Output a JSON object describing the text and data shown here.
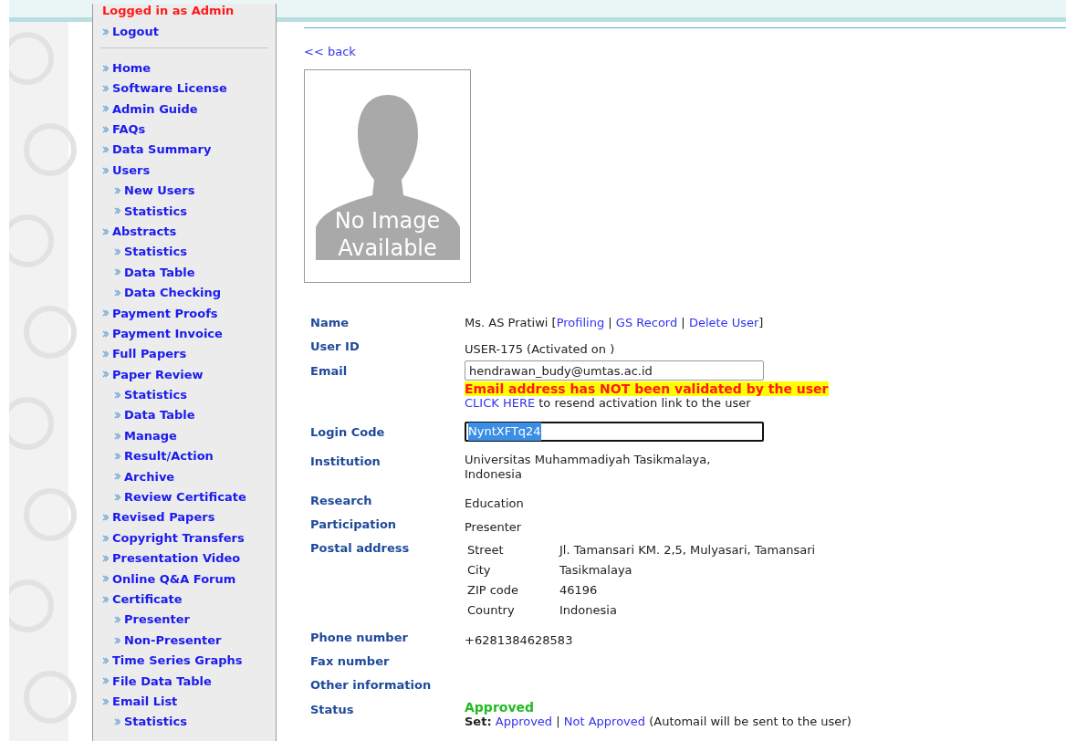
{
  "sidebar": {
    "login_status": "Logged in as Admin",
    "logout": "Logout",
    "items": [
      {
        "label": "Home"
      },
      {
        "label": "Software License"
      },
      {
        "label": "Admin Guide"
      },
      {
        "label": "FAQs"
      },
      {
        "label": "Data Summary"
      },
      {
        "label": "Users",
        "children": [
          {
            "label": "New Users"
          },
          {
            "label": "Statistics"
          }
        ]
      },
      {
        "label": "Abstracts",
        "children": [
          {
            "label": "Statistics"
          },
          {
            "label": "Data Table"
          },
          {
            "label": "Data Checking"
          }
        ]
      },
      {
        "label": "Payment Proofs"
      },
      {
        "label": "Payment Invoice"
      },
      {
        "label": "Full Papers"
      },
      {
        "label": "Paper Review",
        "children": [
          {
            "label": "Statistics"
          },
          {
            "label": "Data Table"
          },
          {
            "label": "Manage"
          },
          {
            "label": "Result/Action"
          },
          {
            "label": "Archive"
          },
          {
            "label": "Review Certificate"
          }
        ]
      },
      {
        "label": "Revised Papers"
      },
      {
        "label": "Copyright Transfers"
      },
      {
        "label": "Presentation Video"
      },
      {
        "label": "Online Q&A Forum"
      },
      {
        "label": "Certificate",
        "children": [
          {
            "label": "Presenter"
          },
          {
            "label": "Non-Presenter"
          }
        ]
      },
      {
        "label": "Time Series Graphs"
      },
      {
        "label": "File Data Table"
      },
      {
        "label": "Email List",
        "children": [
          {
            "label": "Statistics"
          }
        ]
      }
    ]
  },
  "back_link": "<< back",
  "photo": {
    "caption_line1": "No Image",
    "caption_line2": "Available"
  },
  "profile": {
    "name": {
      "label": "Name",
      "value": "Ms. AS Pratiwi",
      "links": [
        "Profiling",
        "GS Record",
        "Delete User"
      ],
      "open_bracket": "[",
      "separator": "|",
      "close_bracket": "]"
    },
    "user_id": {
      "label": "User ID",
      "value": "USER-175 (Activated on )"
    },
    "email": {
      "label": "Email",
      "value": "hendrawan_budy@umtas.ac.id",
      "warning": "Email address has NOT been validated by the user",
      "resend_link": "CLICK HERE",
      "resend_text": "to resend activation link to the user"
    },
    "login_code": {
      "label": "Login Code",
      "value": "NyntXFTq24"
    },
    "institution": {
      "label": "Institution",
      "value_line1": "Universitas Muhammadiyah Tasikmalaya,",
      "value_line2": "Indonesia"
    },
    "research": {
      "label": "Research",
      "value": "Education"
    },
    "participation": {
      "label": "Participation",
      "value": "Presenter"
    },
    "postal": {
      "label": "Postal address",
      "fields": [
        {
          "label": "Street",
          "value": "Jl. Tamansari KM. 2,5, Mulyasari, Tamansari"
        },
        {
          "label": "City",
          "value": "Tasikmalaya"
        },
        {
          "label": "ZIP code",
          "value": "46196"
        },
        {
          "label": "Country",
          "value": "Indonesia"
        }
      ]
    },
    "phone": {
      "label": "Phone number",
      "value": "+6281384628583"
    },
    "fax": {
      "label": "Fax number"
    },
    "other": {
      "label": "Other information"
    },
    "status": {
      "label": "Status",
      "value": "Approved",
      "set_label": "Set:",
      "options": [
        "Approved",
        "Not Approved"
      ],
      "separator": "|",
      "note": "(Automail will be sent to the user)"
    }
  }
}
